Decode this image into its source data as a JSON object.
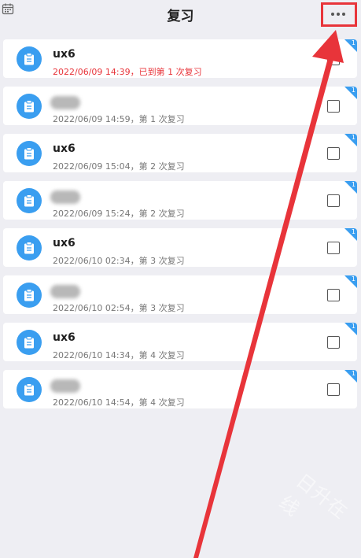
{
  "header": {
    "title": "复习",
    "left_icon": "calendar-icon",
    "right_icon": "more-icon",
    "highlight_color": "#e8343a"
  },
  "items": [
    {
      "name": "ux6",
      "name_blurred": false,
      "subtitle": "2022/06/09 14:39，已到第 1 次复习",
      "overdue": true
    },
    {
      "name": "",
      "name_blurred": true,
      "subtitle": "2022/06/09 14:59，第 1 次复习",
      "overdue": false
    },
    {
      "name": "ux6",
      "name_blurred": false,
      "subtitle": "2022/06/09 15:04，第 2 次复习",
      "overdue": false
    },
    {
      "name": "",
      "name_blurred": true,
      "subtitle": "2022/06/09 15:24，第 2 次复习",
      "overdue": false
    },
    {
      "name": "ux6",
      "name_blurred": false,
      "subtitle": "2022/06/10 02:34，第 3 次复习",
      "overdue": false
    },
    {
      "name": "",
      "name_blurred": true,
      "subtitle": "2022/06/10 02:54，第 3 次复习",
      "overdue": false
    },
    {
      "name": "ux6",
      "name_blurred": false,
      "subtitle": "2022/06/10 14:34，第 4 次复习",
      "overdue": false
    },
    {
      "name": "",
      "name_blurred": true,
      "subtitle": "2022/06/10 14:54，第 4 次复习",
      "overdue": false
    }
  ],
  "corner_mark": "1",
  "colors": {
    "accent": "#3a9ef0",
    "overdue": "#e8343a",
    "background": "#eeeef3"
  },
  "watermark": "日升在线"
}
